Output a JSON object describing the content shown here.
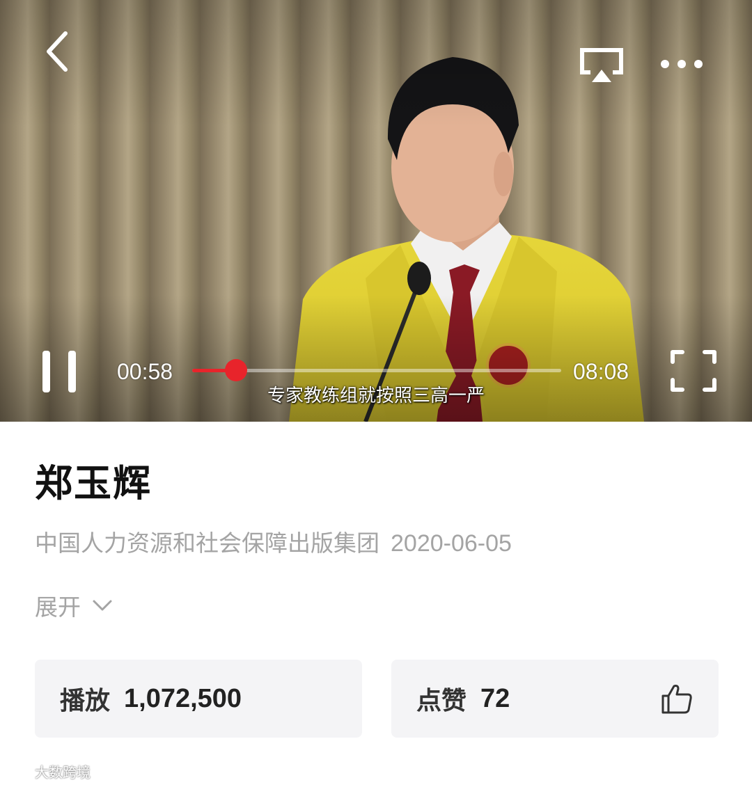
{
  "player": {
    "current_time": "00:58",
    "total_time": "08:08",
    "progress": 0.119,
    "subtitle": "专家教练组就按照三高一严",
    "accent_color": "#e8242b",
    "icons": [
      "back-icon",
      "cast-icon",
      "more-icon",
      "pause-icon",
      "fullscreen-icon"
    ]
  },
  "video_info": {
    "title": "郑玉辉",
    "publisher": "中国人力资源和社会保障出版集团",
    "date": "2020-06-05",
    "expand_label": "展开"
  },
  "stats": {
    "play_label": "播放",
    "play_count": "1,072,500",
    "like_label": "点赞",
    "like_count": "72",
    "like_icon": "thumbs-up-icon"
  },
  "watermark": {
    "text": "大数跨境"
  }
}
